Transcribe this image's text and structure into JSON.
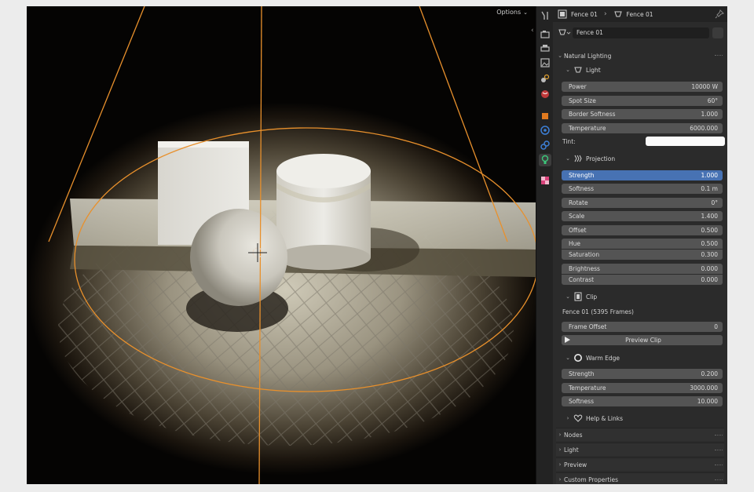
{
  "viewport": {
    "options_label": "Options"
  },
  "breadcrumb": {
    "object": "Fence 01",
    "data": "Fence 01"
  },
  "datablock": {
    "name": "Fence 01"
  },
  "natural_lighting": {
    "title": "Natural Lighting",
    "light": {
      "title": "Light",
      "power": {
        "label": "Power",
        "value": "10000 W"
      },
      "spot_size": {
        "label": "Spot Size",
        "value": "60°"
      },
      "border_softness": {
        "label": "Border Softness",
        "value": "1.000"
      },
      "temperature": {
        "label": "Temperature",
        "value": "6000.000"
      },
      "tint": {
        "label": "Tint:",
        "color": "#fafafa"
      }
    },
    "projection": {
      "title": "Projection",
      "strength": {
        "label": "Strength",
        "value": "1.000"
      },
      "softness": {
        "label": "Softness",
        "value": "0.1 m"
      },
      "rotate": {
        "label": "Rotate",
        "value": "0°"
      },
      "scale": {
        "label": "Scale",
        "value": "1.400"
      },
      "offset": {
        "label": "Offset",
        "value": "0.500"
      },
      "hue": {
        "label": "Hue",
        "value": "0.500"
      },
      "saturation": {
        "label": "Saturation",
        "value": "0.300"
      },
      "brightness": {
        "label": "Brightness",
        "value": "0.000"
      },
      "contrast": {
        "label": "Contrast",
        "value": "0.000"
      }
    },
    "clip": {
      "title": "Clip",
      "info": "Fence 01 (5395 Frames)",
      "frame_offset": {
        "label": "Frame Offset",
        "value": "0"
      },
      "preview_label": "Preview Clip"
    },
    "warm_edge": {
      "title": "Warm Edge",
      "strength": {
        "label": "Strength",
        "value": "0.200"
      },
      "temperature": {
        "label": "Temperature",
        "value": "3000.000"
      },
      "softness": {
        "label": "Softness",
        "value": "10.000"
      }
    },
    "help": {
      "title": "Help & Links"
    }
  },
  "collapsed_panels": [
    "Nodes",
    "Light",
    "Preview",
    "Custom Properties"
  ],
  "colors": {
    "accent": "#4772b3",
    "selection_outline": "#e8902c"
  }
}
